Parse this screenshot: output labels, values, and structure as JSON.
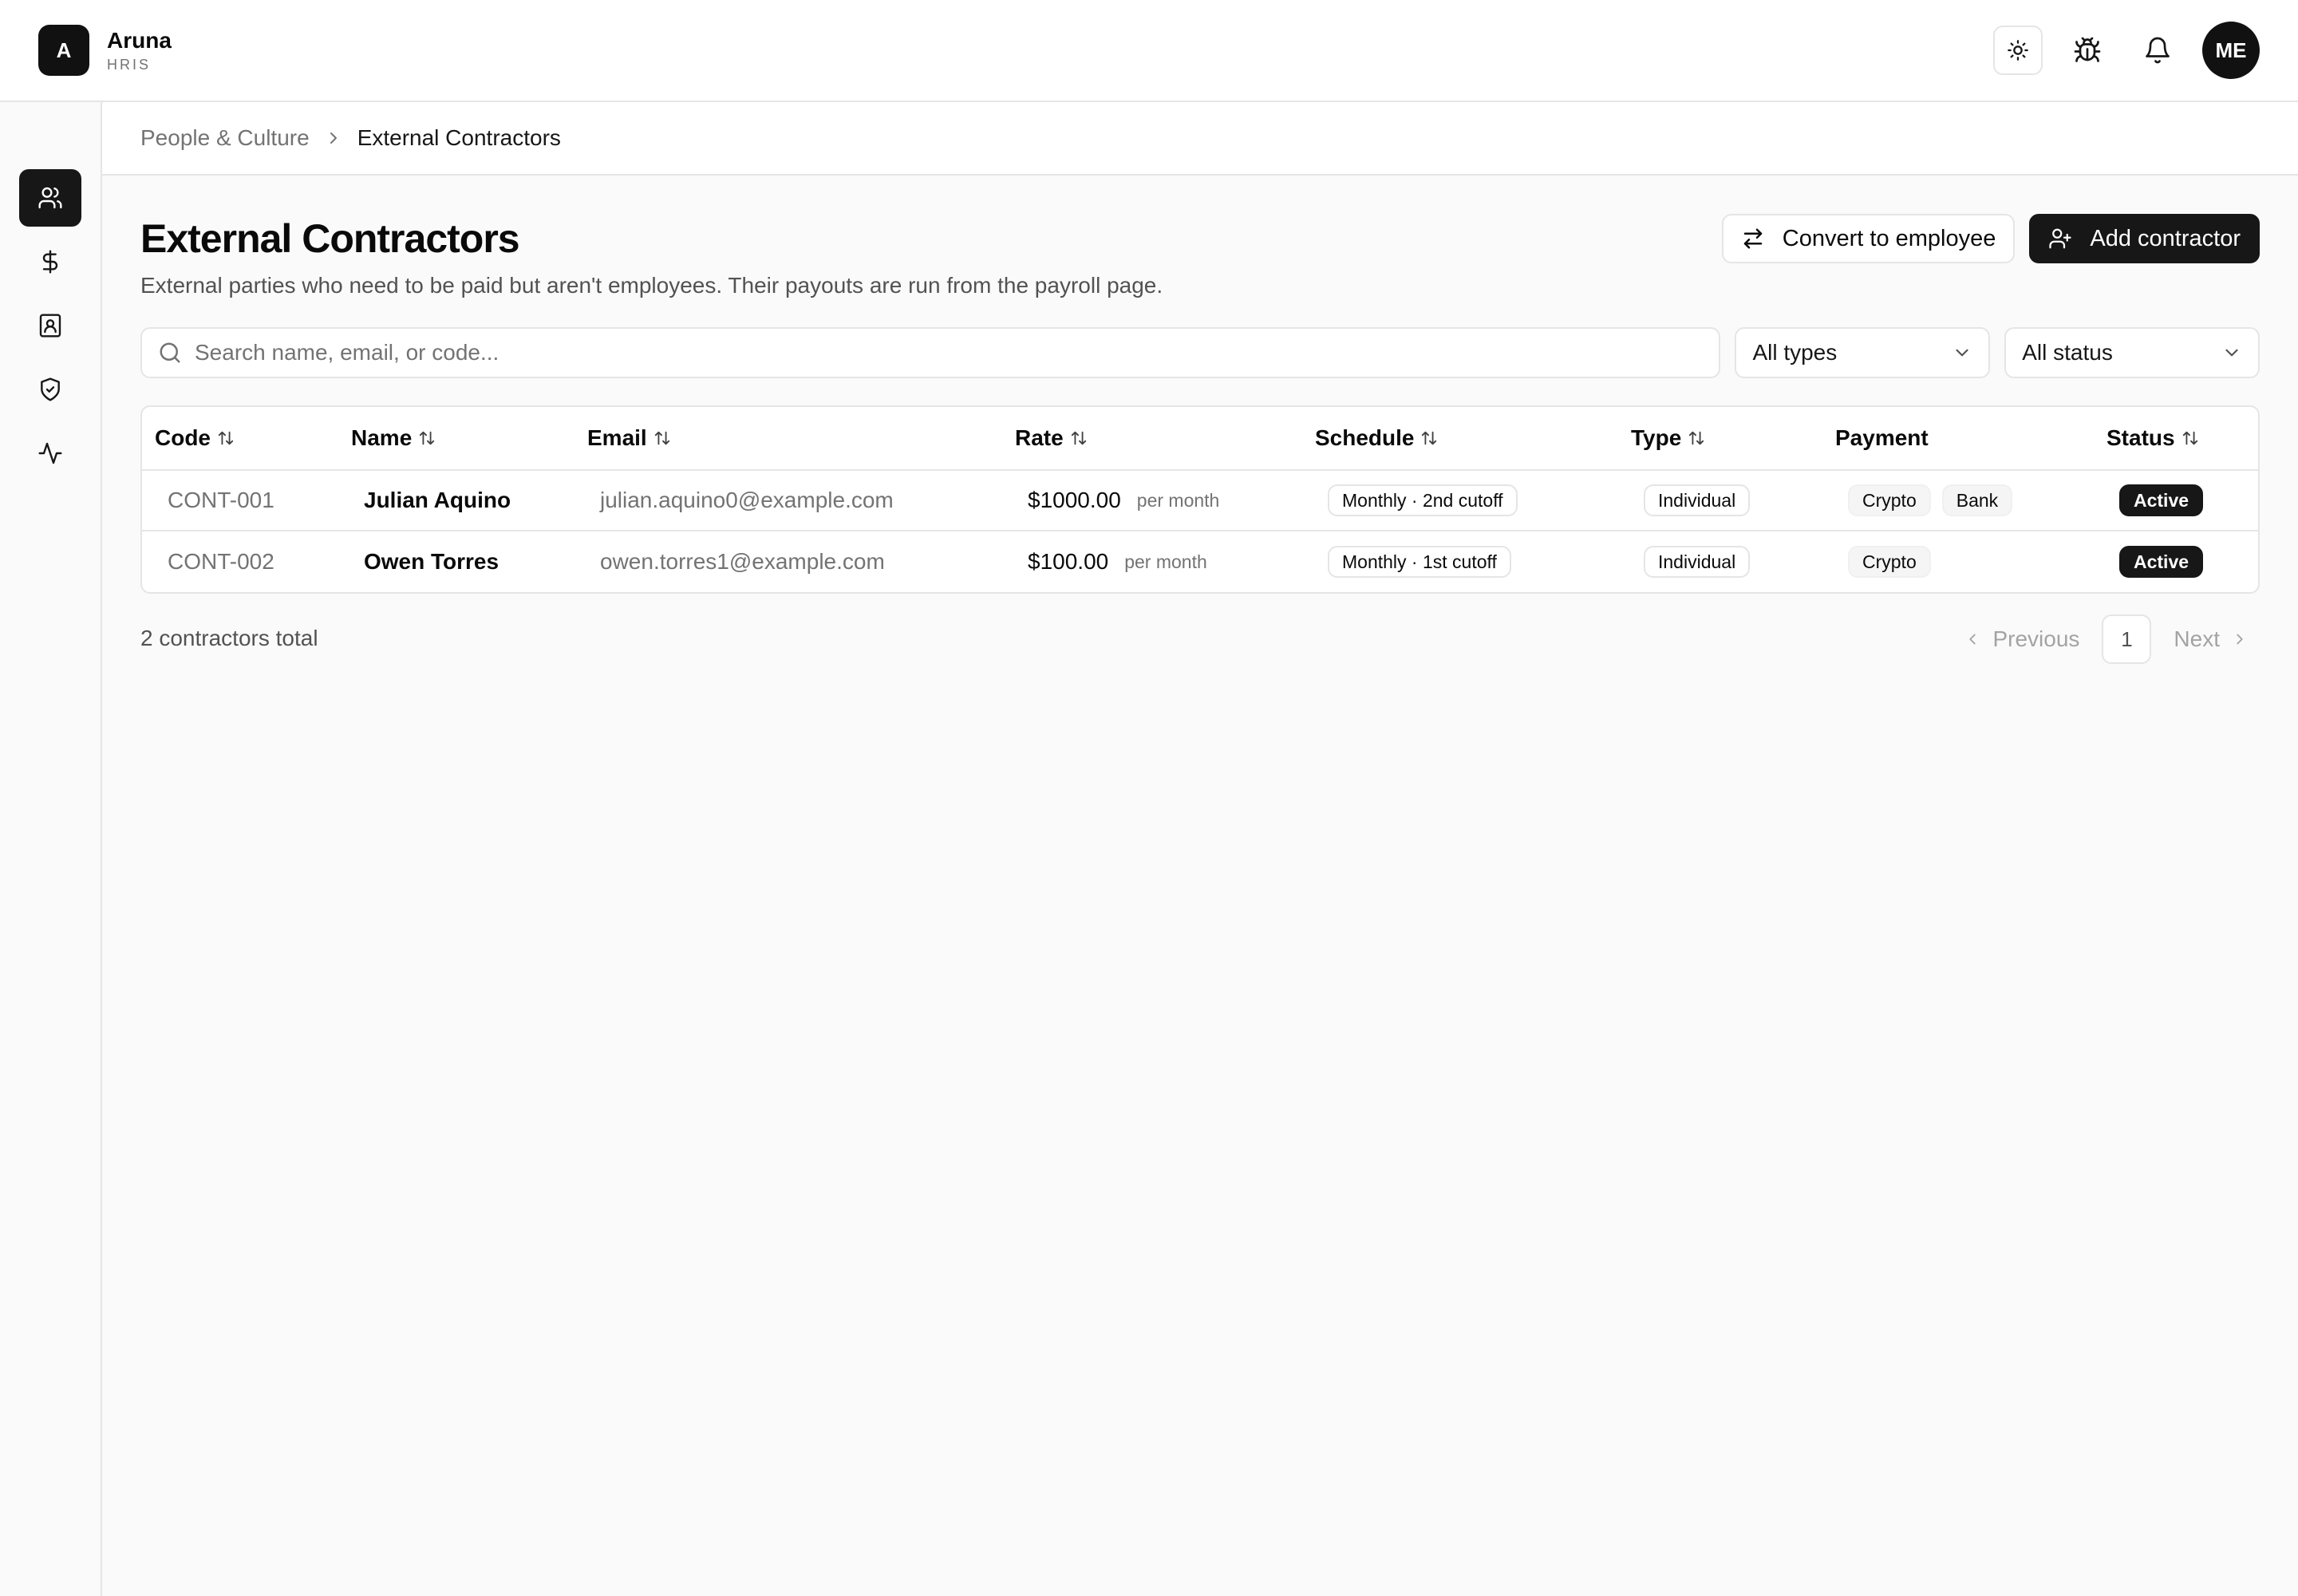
{
  "brand": {
    "logo_letter": "A",
    "name": "Aruna",
    "subtitle": "HRIS"
  },
  "header": {
    "actions": [
      {
        "icon": "sun-icon"
      },
      {
        "icon": "bug-icon"
      },
      {
        "icon": "bell-icon"
      }
    ],
    "avatar_initials": "ME"
  },
  "sidebar": {
    "items": [
      {
        "icon": "users-icon",
        "active": true
      },
      {
        "icon": "dollar-icon",
        "active": false
      },
      {
        "icon": "contact-card-icon",
        "active": false
      },
      {
        "icon": "shield-check-icon",
        "active": false
      },
      {
        "icon": "activity-icon",
        "active": false
      }
    ]
  },
  "breadcrumb": {
    "parent": "People & Culture",
    "current": "External Contractors"
  },
  "page": {
    "title": "External Contractors",
    "description": "External parties who need to be paid but aren't employees. Their payouts are run from the payroll page.",
    "convert_label": "Convert to employee",
    "add_label": "Add contractor"
  },
  "filters": {
    "search_placeholder": "Search name, email, or code...",
    "type_value": "All types",
    "status_value": "All status"
  },
  "table": {
    "columns": [
      "Code",
      "Name",
      "Email",
      "Rate",
      "Schedule",
      "Type",
      "Payment",
      "Status"
    ],
    "rows": [
      {
        "code": "CONT-001",
        "name": "Julian Aquino",
        "email": "julian.aquino0@example.com",
        "rate": "$1000.00",
        "rate_unit": "per month",
        "schedule": "Monthly · 2nd cutoff",
        "type": "Individual",
        "payment": [
          "Crypto",
          "Bank"
        ],
        "status": "Active"
      },
      {
        "code": "CONT-002",
        "name": "Owen Torres",
        "email": "owen.torres1@example.com",
        "rate": "$100.00",
        "rate_unit": "per month",
        "schedule": "Monthly · 1st cutoff",
        "type": "Individual",
        "payment": [
          "Crypto"
        ],
        "status": "Active"
      }
    ]
  },
  "footer": {
    "total": "2 contractors total",
    "prev_label": "Previous",
    "page": "1",
    "next_label": "Next"
  },
  "colors": {
    "accent": "#171717",
    "border": "#e5e5e5",
    "muted_text": "#737373",
    "background": "#fafafa"
  }
}
